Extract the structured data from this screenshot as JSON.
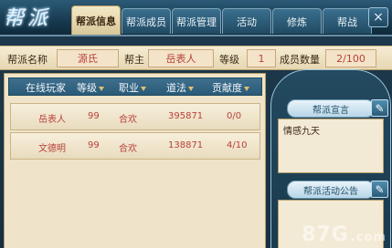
{
  "header": {
    "logo_text": "帮派",
    "tabs": [
      {
        "label": "帮派信息",
        "active": true
      },
      {
        "label": "帮派成员",
        "active": false
      },
      {
        "label": "帮派管理",
        "active": false
      },
      {
        "label": "活动",
        "active": false
      },
      {
        "label": "修炼",
        "active": false
      },
      {
        "label": "帮战",
        "active": false
      }
    ],
    "close_label": "×"
  },
  "info": {
    "name_label": "帮派名称",
    "name_value": "源氏",
    "leader_label": "帮主",
    "leader_value": "岳表人",
    "level_label": "等级",
    "level_value": "1",
    "members_label": "成员数量",
    "members_value": "2/100"
  },
  "table": {
    "headers": [
      "在线玩家",
      "等级",
      "职业",
      "道法",
      "贡献度"
    ],
    "rows": [
      {
        "name": "岳表人",
        "level": "99",
        "job": "合欢",
        "dao": "395871",
        "contrib": "0/0"
      },
      {
        "name": "文德明",
        "level": "99",
        "job": "合欢",
        "dao": "138871",
        "contrib": "4/10"
      }
    ]
  },
  "notice": {
    "title": "帮派宣言",
    "content": "情感九天",
    "edit_icon": "pencil-edit-icon"
  },
  "activity": {
    "title": "帮派活动公告",
    "content": "",
    "edit_icon": "pencil-edit-icon"
  },
  "watermark": {
    "text": "87G",
    "suffix": ".com"
  },
  "colors": {
    "accent_gold": "#d9c79a",
    "value_red": "#b8413a",
    "panel_blue": "#295a78"
  }
}
